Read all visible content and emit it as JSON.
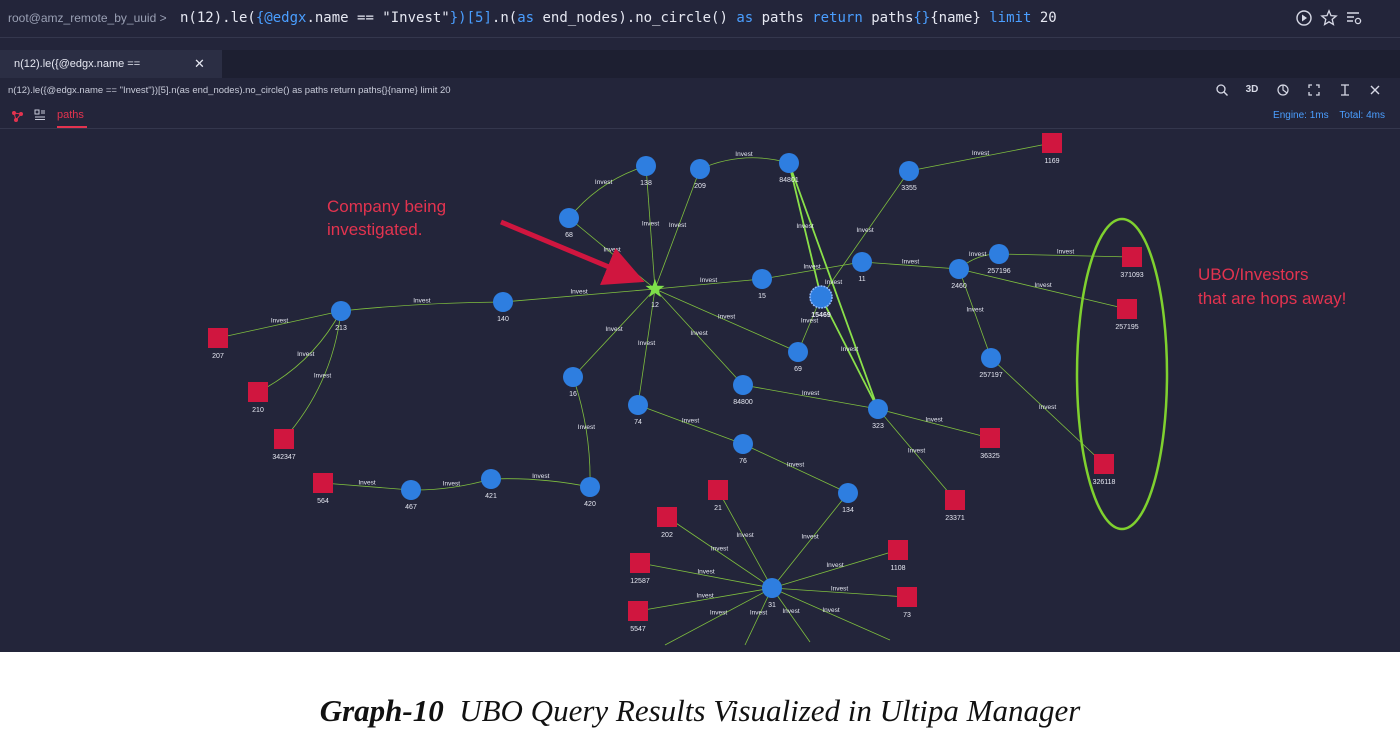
{
  "query_bar": {
    "prefix": "root@amz_remote_by_uuid >",
    "segments": [
      {
        "t": "n(12).le(",
        "kw": false
      },
      {
        "t": "{@edgx",
        "kw": true
      },
      {
        "t": ".name == \"Invest\"",
        "kw": false
      },
      {
        "t": "})[5]",
        "kw": true
      },
      {
        "t": ".n(",
        "kw": false
      },
      {
        "t": "as",
        "kw": true
      },
      {
        "t": " end_nodes).no_circle() ",
        "kw": false
      },
      {
        "t": "as",
        "kw": true
      },
      {
        "t": " paths ",
        "kw": false
      },
      {
        "t": "return",
        "kw": true
      },
      {
        "t": " paths",
        "kw": false
      },
      {
        "t": "{}",
        "kw": true
      },
      {
        "t": "{name} ",
        "kw": false
      },
      {
        "t": "limit",
        "kw": true
      },
      {
        "t": " 20",
        "kw": false
      }
    ],
    "icons": [
      "run-icon",
      "star-icon",
      "list-settings-icon"
    ]
  },
  "tab": {
    "label": "n(12).le({@edgx.name ==",
    "close": "✕"
  },
  "toolbar": {
    "query": "n(12).le({@edgx.name == \"Invest\"})[5].n(as end_nodes).no_circle() as paths return paths{}{name} limit 20",
    "icons": [
      "search-icon",
      "3d-icon",
      "style-icon",
      "fullscreen-icon",
      "pin-icon",
      "close-icon"
    ],
    "label_3d": "3D"
  },
  "result_tabs": {
    "active": "paths"
  },
  "timing": {
    "engine": "Engine: 1ms",
    "total": "Total: 4ms"
  },
  "colors": {
    "company_node": "#2e7ee0",
    "investor_node": "#d0163f",
    "edge": "#7fbf3f",
    "highlight_star": "#7ee04a",
    "annotation": "#e3334f",
    "circle": "#7fd12f"
  },
  "graph": {
    "edge_label": "Invest",
    "nodes": [
      {
        "id": "12",
        "type": "star"
      },
      {
        "id": "138",
        "type": "circle"
      },
      {
        "id": "209",
        "type": "circle"
      },
      {
        "id": "84801",
        "type": "circle"
      },
      {
        "id": "3355",
        "type": "circle"
      },
      {
        "id": "1169",
        "type": "square"
      },
      {
        "id": "68",
        "type": "circle"
      },
      {
        "id": "140",
        "type": "circle"
      },
      {
        "id": "213",
        "type": "circle"
      },
      {
        "id": "207",
        "type": "square"
      },
      {
        "id": "210",
        "type": "square"
      },
      {
        "id": "342347",
        "type": "square"
      },
      {
        "id": "15",
        "type": "circle"
      },
      {
        "id": "11",
        "type": "circle"
      },
      {
        "id": "15469",
        "type": "bigcircle"
      },
      {
        "id": "69",
        "type": "circle"
      },
      {
        "id": "16",
        "type": "circle"
      },
      {
        "id": "74",
        "type": "circle"
      },
      {
        "id": "84800",
        "type": "circle"
      },
      {
        "id": "323",
        "type": "circle"
      },
      {
        "id": "76",
        "type": "circle"
      },
      {
        "id": "134",
        "type": "circle"
      },
      {
        "id": "2460",
        "type": "circle"
      },
      {
        "id": "257196",
        "type": "circle"
      },
      {
        "id": "371093",
        "type": "square"
      },
      {
        "id": "257195",
        "type": "square"
      },
      {
        "id": "257197",
        "type": "circle"
      },
      {
        "id": "326118",
        "type": "square"
      },
      {
        "id": "36325",
        "type": "square"
      },
      {
        "id": "23371",
        "type": "square"
      },
      {
        "id": "564",
        "type": "square"
      },
      {
        "id": "467",
        "type": "circle"
      },
      {
        "id": "421",
        "type": "circle"
      },
      {
        "id": "420",
        "type": "circle"
      },
      {
        "id": "21",
        "type": "square"
      },
      {
        "id": "202",
        "type": "square"
      },
      {
        "id": "12587",
        "type": "square"
      },
      {
        "id": "5547",
        "type": "square"
      },
      {
        "id": "31",
        "type": "star-circle"
      },
      {
        "id": "1108",
        "type": "square"
      },
      {
        "id": "73",
        "type": "square"
      }
    ]
  },
  "annotations": {
    "company": [
      "Company being",
      "investigated."
    ],
    "ubo": [
      "UBO/Investors",
      "that are hops away!"
    ]
  },
  "caption": {
    "bold": "Graph-10",
    "rest": "UBO Query Results Visualized in Ultipa Manager"
  }
}
